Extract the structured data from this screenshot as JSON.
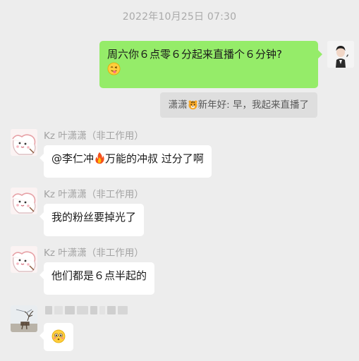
{
  "chat": {
    "timestamp": "2022年10月25日 07:30",
    "outgoing": {
      "line1": "周六你６点零６分起来直播个６分钟?",
      "emoji": "tongue-face-emoji"
    },
    "quote": {
      "prefix": "潇潇",
      "emoji": "tiger-emoji",
      "suffix": "新年好: 早，我起来直播了"
    },
    "incoming": [
      {
        "sender": "Kz 叶潇潇（非工作用）",
        "text_before": "@李仁冲",
        "emoji": "fire-emoji",
        "text_after": "万能的冲叔 过分了啊"
      },
      {
        "sender": "Kz 叶潇潇（非工作用）",
        "text": "我的粉丝要掉光了"
      },
      {
        "sender": "Kz 叶潇潇（非工作用）",
        "text": "他们都是６点半起的"
      }
    ],
    "last_message": {
      "sender_name": "",
      "emoji": "flushed-face-emoji"
    }
  },
  "colors": {
    "background": "#ededed",
    "outgoing_bubble": "#95ec69",
    "incoming_bubble": "#ffffff",
    "quote_bg": "#dedede",
    "meta_text": "#a3a3a3"
  }
}
